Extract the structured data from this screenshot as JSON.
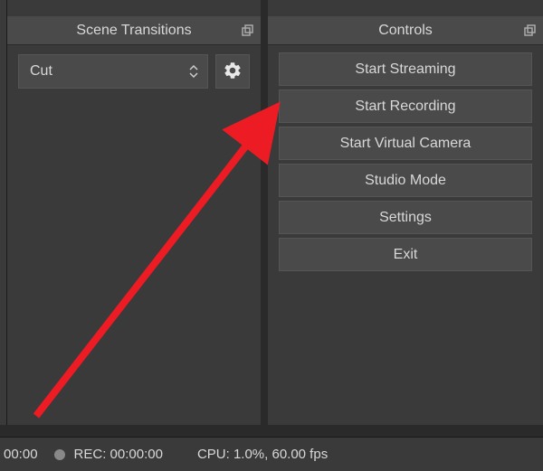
{
  "scene_transitions": {
    "title": "Scene Transitions",
    "selected": "Cut"
  },
  "controls": {
    "title": "Controls",
    "buttons": {
      "start_streaming": "Start Streaming",
      "start_recording": "Start Recording",
      "start_virtual_camera": "Start Virtual Camera",
      "studio_mode": "Studio Mode",
      "settings": "Settings",
      "exit": "Exit"
    }
  },
  "status": {
    "time_partial": "00:00",
    "rec_label": "REC: 00:00:00",
    "cpu": "CPU: 1.0%, 60.00 fps"
  }
}
